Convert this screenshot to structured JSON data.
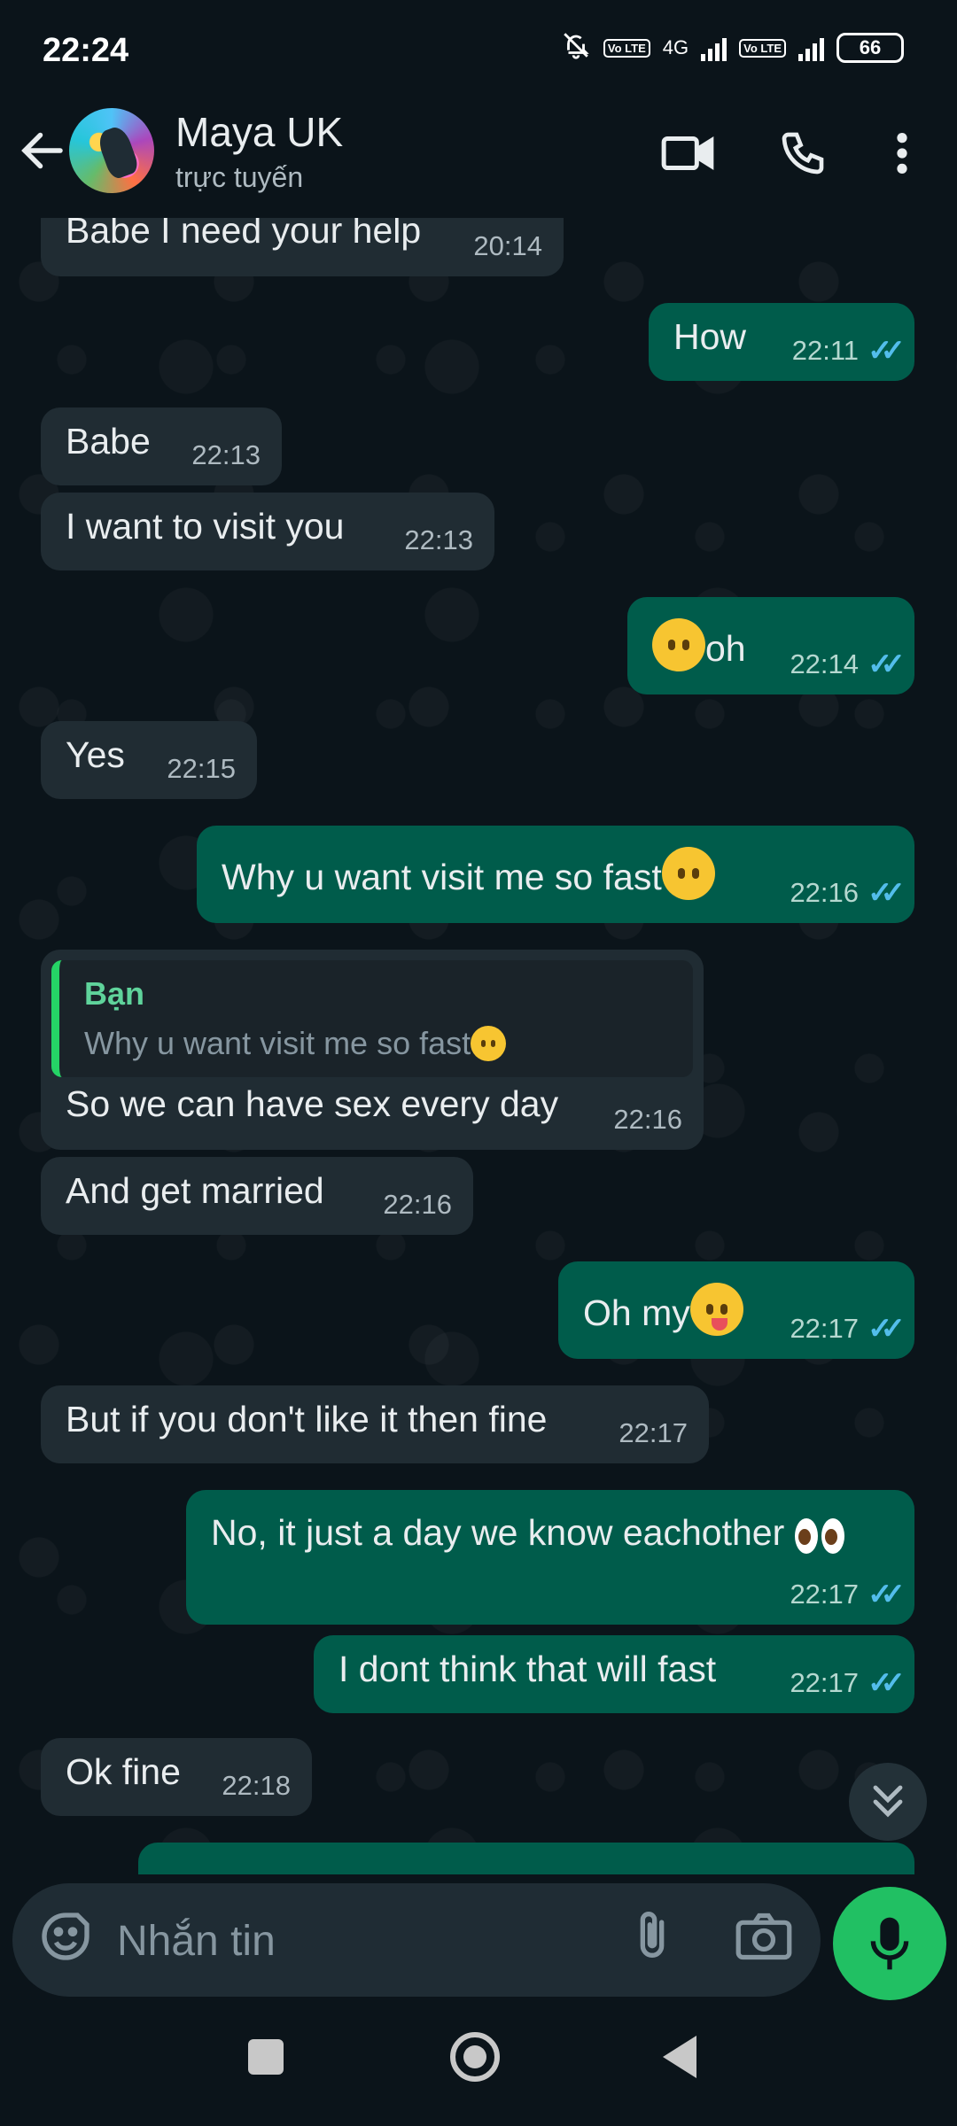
{
  "status_bar": {
    "time": "22:24",
    "volte_label": "Vo LTE",
    "network_label": "4G",
    "battery": "66"
  },
  "header": {
    "contact_name": "Maya UK",
    "contact_status": "trực tuyến",
    "icons": [
      "back-arrow-icon",
      "video-call-icon",
      "phone-icon",
      "more-options-icon"
    ]
  },
  "messages": [
    {
      "dir": "in",
      "text": "Babe I need your help",
      "time": "20:14"
    },
    {
      "dir": "out",
      "text": "How",
      "time": "22:11",
      "status": "read"
    },
    {
      "dir": "in",
      "text": "Babe",
      "time": "22:13"
    },
    {
      "dir": "in",
      "text": "I want to visit you",
      "time": "22:13"
    },
    {
      "dir": "out",
      "text": "oh",
      "emoji": "neutral-face",
      "time": "22:14",
      "status": "read"
    },
    {
      "dir": "in",
      "text": "Yes",
      "time": "22:15"
    },
    {
      "dir": "out",
      "text": "Why u want visit me so fast",
      "emoji": "neutral-face",
      "time": "22:16",
      "status": "read"
    },
    {
      "dir": "in",
      "reply_to": {
        "author": "Bạn",
        "text": "Why u want visit me so fast"
      },
      "text": "So we can have sex every day",
      "time": "22:16"
    },
    {
      "dir": "in",
      "text": "And get married",
      "time": "22:16"
    },
    {
      "dir": "out",
      "text": "Oh my",
      "emoji": "yum-face",
      "time": "22:17",
      "status": "read"
    },
    {
      "dir": "in",
      "text": "But if you don't like it then fine",
      "time": "22:17"
    },
    {
      "dir": "out",
      "text": "No, it just a day we know eachother",
      "emoji": "eyes",
      "time": "22:17",
      "status": "read"
    },
    {
      "dir": "out",
      "text": "I dont think that will fast",
      "time": "22:17",
      "status": "read"
    },
    {
      "dir": "in",
      "text": "Ok fine",
      "time": "22:18"
    }
  ],
  "input": {
    "placeholder": "Nhắn tin"
  },
  "colors": {
    "background": "#0b141a",
    "incoming_bubble": "#202c33",
    "outgoing_bubble": "#005c4b",
    "read_ticks": "#53bdeb",
    "mic_button": "#21c063",
    "reply_accent": "#25d366"
  }
}
